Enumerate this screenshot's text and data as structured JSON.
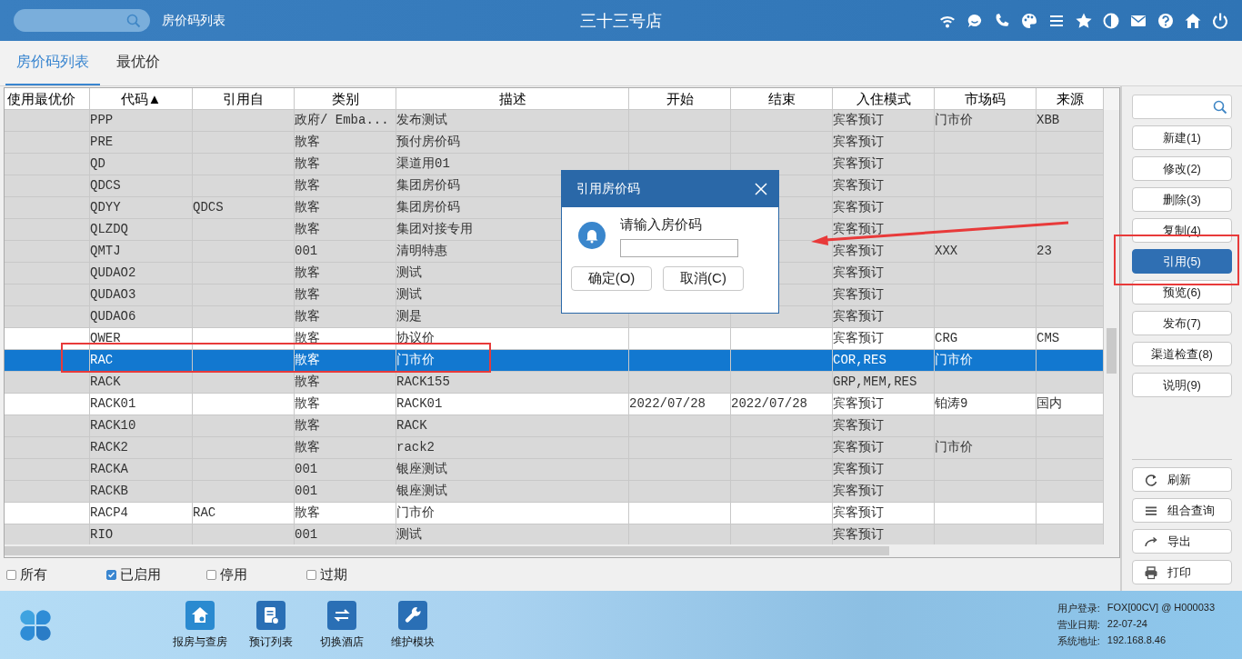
{
  "header": {
    "page_title": "房价码列表",
    "hotel_name": "三十三号店"
  },
  "tabs": [
    {
      "label": "房价码列表",
      "selected": true
    },
    {
      "label": "最优价",
      "selected": false
    }
  ],
  "table": {
    "columns": [
      "使用最优价",
      "代码▲",
      "引用自",
      "类别",
      "描述",
      "开始",
      "结束",
      "入住模式",
      "市场码",
      "来源"
    ],
    "rows": [
      {
        "shaded": true,
        "selected": false,
        "cells": {
          "code": "PPP",
          "cat": "政府/ Emba...",
          "desc": "发布测试",
          "mode": "宾客预订",
          "market": "门市价",
          "src": "XBB"
        }
      },
      {
        "shaded": true,
        "selected": false,
        "cells": {
          "code": "PRE",
          "cat": "散客",
          "desc": "预付房价码",
          "mode": "宾客预订"
        }
      },
      {
        "shaded": true,
        "selected": false,
        "cells": {
          "code": "QD",
          "cat": "散客",
          "desc": "渠道用01",
          "mode": "宾客预订"
        }
      },
      {
        "shaded": true,
        "selected": false,
        "cells": {
          "code": "QDCS",
          "cat": "散客",
          "desc": "集团房价码",
          "mode": "宾客预订"
        }
      },
      {
        "shaded": true,
        "selected": false,
        "cells": {
          "code": "QDYY",
          "ref": "QDCS",
          "cat": "散客",
          "desc": "集团房价码",
          "mode": "宾客预订"
        }
      },
      {
        "shaded": true,
        "selected": false,
        "cells": {
          "code": "QLZDQ",
          "cat": "散客",
          "desc": "集团对接专用",
          "mode": "宾客预订"
        }
      },
      {
        "shaded": true,
        "selected": false,
        "cells": {
          "code": "QMTJ",
          "cat": "001",
          "desc": "清明特惠",
          "mode": "宾客预订",
          "market": "XXX",
          "src": "23"
        }
      },
      {
        "shaded": true,
        "selected": false,
        "cells": {
          "code": "QUDAO2",
          "cat": "散客",
          "desc": "测试",
          "mode": "宾客预订"
        }
      },
      {
        "shaded": true,
        "selected": false,
        "cells": {
          "code": "QUDAO3",
          "cat": "散客",
          "desc": "测试",
          "mode": "宾客预订"
        }
      },
      {
        "shaded": true,
        "selected": false,
        "cells": {
          "code": "QUDAO6",
          "cat": "散客",
          "desc": "测是",
          "mode": "宾客预订"
        }
      },
      {
        "shaded": false,
        "selected": false,
        "cells": {
          "code": "QWER",
          "cat": "散客",
          "desc": "协议价",
          "mode": "宾客预订",
          "market": "CRG",
          "src": "CMS"
        }
      },
      {
        "selected": true,
        "cells": {
          "code": "RAC",
          "cat": "散客",
          "desc": "门市价",
          "mode": "COR,RES",
          "market": "门市价"
        }
      },
      {
        "shaded": true,
        "selected": false,
        "cells": {
          "code": "RACK",
          "cat": "散客",
          "desc": "RACK155",
          "mode": "GRP,MEM,RES"
        }
      },
      {
        "shaded": false,
        "selected": false,
        "cells": {
          "code": "RACK01",
          "cat": "散客",
          "desc": "RACK01",
          "start": "2022/07/28",
          "end": "2022/07/28",
          "mode": "宾客预订",
          "market": "铂涛9",
          "src": "国内"
        }
      },
      {
        "shaded": true,
        "selected": false,
        "cells": {
          "code": "RACK10",
          "cat": "散客",
          "desc": "RACK",
          "mode": "宾客预订"
        }
      },
      {
        "shaded": true,
        "selected": false,
        "cells": {
          "code": "RACK2",
          "cat": "散客",
          "desc": "rack2",
          "mode": "宾客预订",
          "market": "门市价"
        }
      },
      {
        "shaded": true,
        "selected": false,
        "cells": {
          "code": "RACKA",
          "cat": "001",
          "desc": "银座测试",
          "mode": "宾客预订"
        }
      },
      {
        "shaded": true,
        "selected": false,
        "cells": {
          "code": "RACKB",
          "cat": "001",
          "desc": "银座测试",
          "mode": "宾客预订"
        }
      },
      {
        "shaded": false,
        "selected": false,
        "cells": {
          "code": "RACP4",
          "ref": "RAC",
          "cat": "散客",
          "desc": "门市价",
          "mode": "宾客预订"
        }
      },
      {
        "shaded": true,
        "selected": false,
        "cells": {
          "code": "RIO",
          "cat": "001",
          "desc": "测试",
          "mode": "宾客预订"
        }
      }
    ]
  },
  "filters": [
    {
      "label": "所有",
      "checked": false
    },
    {
      "label": "已启用",
      "checked": true
    },
    {
      "label": "停用",
      "checked": false
    },
    {
      "label": "过期",
      "checked": false
    }
  ],
  "side_panel": {
    "actions": [
      {
        "label": "新建(1)",
        "selected": false
      },
      {
        "label": "修改(2)",
        "selected": false
      },
      {
        "label": "删除(3)",
        "selected": false
      },
      {
        "label": "复制(4)",
        "selected": false
      },
      {
        "label": "引用(5)",
        "selected": true
      },
      {
        "label": "预览(6)",
        "selected": false
      },
      {
        "label": "发布(7)",
        "selected": false
      },
      {
        "label": "渠道检查(8)",
        "selected": false
      },
      {
        "label": "说明(9)",
        "selected": false
      }
    ],
    "tools": [
      {
        "kind": "refresh",
        "label": "刷新"
      },
      {
        "kind": "query",
        "label": "组合查询"
      },
      {
        "kind": "export",
        "label": "导出"
      },
      {
        "kind": "print",
        "label": "打印"
      }
    ]
  },
  "dialog": {
    "title": "引用房价码",
    "prompt": "请输入房价码",
    "buttons": [
      "确定(O)",
      "取消(C)"
    ]
  },
  "footer": {
    "apps": [
      {
        "kind": "house",
        "label": "报房与查房"
      },
      {
        "kind": "list",
        "label": "预订列表"
      },
      {
        "kind": "switch",
        "label": "切换酒店"
      },
      {
        "kind": "wrench",
        "label": "维护模块"
      }
    ],
    "info": [
      {
        "label": "用户登录:",
        "value": "FOX[00CV] @ H000033"
      },
      {
        "label": "营业日期:",
        "value": "22-07-24"
      },
      {
        "label": "系统地址:",
        "value": "192.168.8.46"
      }
    ]
  }
}
